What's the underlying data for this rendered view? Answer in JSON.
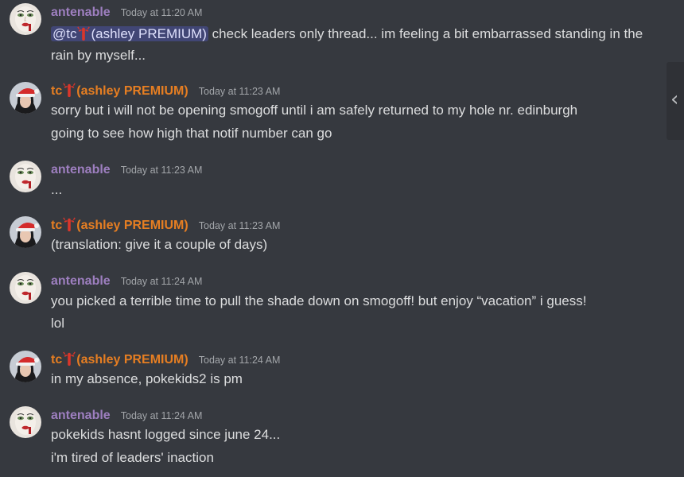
{
  "users": {
    "antenable": {
      "name": "antenable",
      "color": "#9e7fc0",
      "avatar": "clown-face-avatar"
    },
    "tc": {
      "name_prefix": "tc",
      "name_suffix": "(ashley PREMIUM)",
      "emoji": "lobster-icon",
      "color": "#e67e22",
      "avatar": "santa-hat-avatar"
    }
  },
  "messages": [
    {
      "author": "antenable",
      "timestamp": "Today at 11:20 AM",
      "mention_prefix": "@tc",
      "mention_suffix": "(ashley PREMIUM)",
      "line1_rest": " check leaders only thread... im feeling a bit embarrassed standing in the",
      "line2": "rain by myself..."
    },
    {
      "author": "tc",
      "timestamp": "Today at 11:23 AM",
      "lines": [
        "sorry but i will not be opening smogoff until i am safely returned to my hole nr. edinburgh",
        "going to see how high that notif number can go"
      ]
    },
    {
      "author": "antenable",
      "timestamp": "Today at 11:23 AM",
      "lines": [
        "..."
      ]
    },
    {
      "author": "tc",
      "timestamp": "Today at 11:23 AM",
      "lines": [
        "(translation: give it a couple of days)"
      ]
    },
    {
      "author": "antenable",
      "timestamp": "Today at 11:24 AM",
      "lines": [
        "you picked a terrible time to pull the shade down on smogoff! but enjoy “vacation” i guess!",
        "lol"
      ]
    },
    {
      "author": "tc",
      "timestamp": "Today at 11:24 AM",
      "lines": [
        "in my absence, pokekids2 is pm"
      ]
    },
    {
      "author": "antenable",
      "timestamp": "Today at 11:24 AM",
      "lines": [
        "pokekids hasnt logged since june 24...",
        "i'm tired of leaders' inaction"
      ]
    }
  ],
  "scroll_handle": {
    "icon": "chevron-left-icon",
    "glyph": "‹"
  }
}
